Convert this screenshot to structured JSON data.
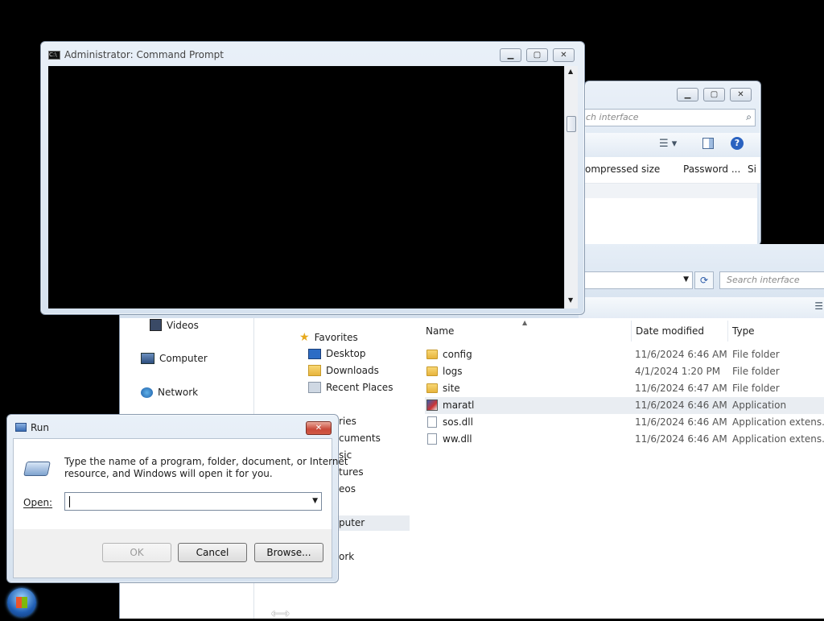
{
  "cmd": {
    "title": "Administrator: Command Prompt"
  },
  "zip_window": {
    "search_placeholder": "ch interface",
    "columns": [
      "ompressed size",
      "Password ...",
      "Si"
    ]
  },
  "explorer": {
    "search_placeholder": "Search interface",
    "sidebar_left": [
      {
        "label": "Videos",
        "icon": "video-icon"
      },
      {
        "label": "Computer",
        "icon": "computer-icon"
      },
      {
        "label": "Network",
        "icon": "network-icon"
      }
    ],
    "favorites_header": "Favorites",
    "favorites": [
      {
        "label": "Desktop",
        "icon": "desktop-icon"
      },
      {
        "label": "Downloads",
        "icon": "downloads-icon"
      },
      {
        "label": "Recent Places",
        "icon": "recent-places-icon"
      }
    ],
    "partial_nav": [
      "ries",
      "cuments",
      "sic",
      "tures",
      "eos",
      "puter",
      "ork"
    ],
    "columns": {
      "name": "Name",
      "date": "Date modified",
      "type": "Type"
    },
    "files": [
      {
        "name": "config",
        "date": "11/6/2024 6:46 AM",
        "type": "File folder",
        "icon": "folder-icon"
      },
      {
        "name": "logs",
        "date": "4/1/2024 1:20 PM",
        "type": "File folder",
        "icon": "folder-icon"
      },
      {
        "name": "site",
        "date": "11/6/2024 6:47 AM",
        "type": "File folder",
        "icon": "folder-icon"
      },
      {
        "name": "maratl",
        "date": "11/6/2024 6:46 AM",
        "type": "Application",
        "icon": "application-icon"
      },
      {
        "name": "sos.dll",
        "date": "11/6/2024 6:46 AM",
        "type": "Application extens...",
        "icon": "dll-icon"
      },
      {
        "name": "ww.dll",
        "date": "11/6/2024 6:46 AM",
        "type": "Application extens...",
        "icon": "dll-icon"
      }
    ]
  },
  "run": {
    "title": "Run",
    "description_line1": "Type the name of a program, folder, document, or Internet",
    "description_line2": "resource, and Windows will open it for you.",
    "open_label": "Open:",
    "open_value": "",
    "ok": "OK",
    "cancel": "Cancel",
    "browse": "Browse..."
  }
}
